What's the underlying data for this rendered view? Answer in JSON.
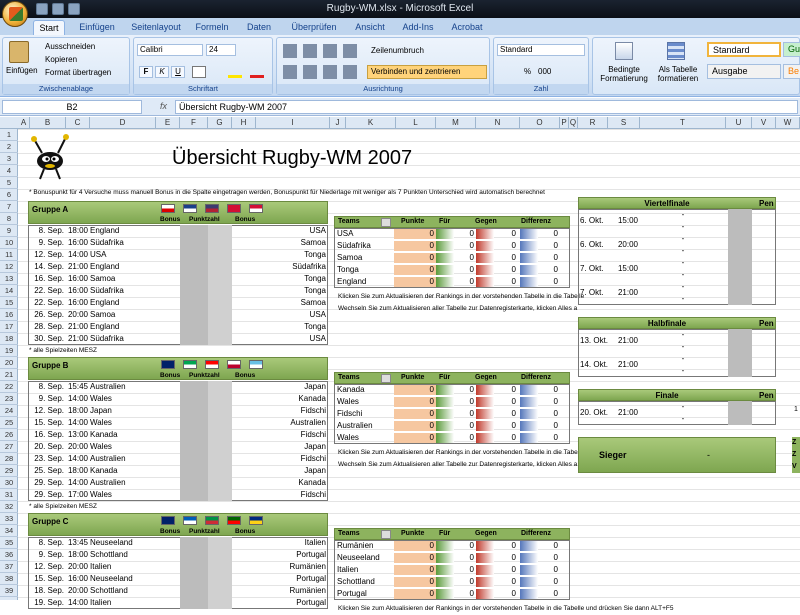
{
  "window": {
    "title": "Rugby-WM.xlsx - Microsoft Excel"
  },
  "tabs": [
    "Start",
    "Einfügen",
    "Seitenlayout",
    "Formeln",
    "Daten",
    "Überprüfen",
    "Ansicht",
    "Add-Ins",
    "Acrobat"
  ],
  "ribbon": {
    "clipboard": {
      "label": "Zwischenablage",
      "paste": "Einfügen",
      "cut": "Ausschneiden",
      "copy": "Kopieren",
      "format_painter": "Format übertragen"
    },
    "font": {
      "label": "Schriftart",
      "name": "Calibri",
      "size": "24",
      "bold": "F",
      "italic": "K",
      "underline": "U"
    },
    "alignment": {
      "label": "Ausrichtung",
      "wrap": "Zeilenumbruch",
      "merge": "Verbinden und zentrieren"
    },
    "number": {
      "label": "Zahl",
      "format": "Standard",
      "percent": "%",
      "thousands": "000"
    },
    "styles": {
      "cond_format": "Bedingte Formatierung",
      "table_format": "Als Tabelle formatieren",
      "style_standard": "Standard",
      "style_ausgabe": "Ausgabe",
      "style_gut": "Gu",
      "style_berechnung": "Be"
    }
  },
  "formula_bar": {
    "name_box": "B2",
    "fx": "fx",
    "value": "Übersicht Rugby-WM 2007"
  },
  "columns": [
    "A",
    "B",
    "C",
    "D",
    "E",
    "F",
    "G",
    "H",
    "I",
    "J",
    "K",
    "L",
    "M",
    "N",
    "O",
    "P",
    "Q",
    "R",
    "S",
    "T",
    "U",
    "V",
    "W"
  ],
  "rows": [
    "1",
    "2",
    "3",
    "4",
    "5",
    "6",
    "7",
    "8",
    "9",
    "10",
    "11",
    "12",
    "13",
    "14",
    "15",
    "16",
    "17",
    "18",
    "19",
    "20",
    "21",
    "22",
    "23",
    "24",
    "25",
    "26",
    "27",
    "28",
    "29",
    "30",
    "31",
    "32",
    "33",
    "34",
    "35",
    "36",
    "37",
    "38",
    "39"
  ],
  "sheet": {
    "title": "Übersicht Rugby-WM 2007",
    "note": "* Bonuspunkt für 4 Versuche muss manuell Bonus in die Spalte eingetragen werden, Bonuspunkt für Niederlage mit weniger als 7 Punkten Unterschied wird automatisch berechnet",
    "tz_note": "* alle Spielzeiten MESZ",
    "col_bonus": "Bonus",
    "col_punktzahl": "Punktzahl",
    "standing_cols": {
      "teams": "Teams",
      "punkte": "Punkte",
      "fuer": "Für",
      "gegen": "Gegen",
      "differenz": "Differenz"
    },
    "click_note": "Klicken Sie zum Aktualisieren der Rankings in der vorstehenden Tabelle in die Tabelle",
    "click_note_c": "Klicken Sie zum Aktualisieren der Rankings in der vorstehenden Tabelle in die Tabelle und drücken Sie dann ALT+F5",
    "refresh_note": "Wechseln Sie zum Aktualisieren aller Tabelle zur Datenregisterkarte, klicken Alles a",
    "zero": "0",
    "groups": [
      {
        "name": "Gruppe A",
        "matches": [
          [
            "8. Sep.",
            "18:00",
            "England",
            "USA"
          ],
          [
            "9. Sep.",
            "16:00",
            "Südafrika",
            "Samoa"
          ],
          [
            "12. Sep.",
            "14:00",
            "USA",
            "Tonga"
          ],
          [
            "14. Sep.",
            "21:00",
            "England",
            "Südafrika"
          ],
          [
            "16. Sep.",
            "16:00",
            "Samoa",
            "Tonga"
          ],
          [
            "22. Sep.",
            "16:00",
            "Südafrika",
            "Tonga"
          ],
          [
            "22. Sep.",
            "16:00",
            "England",
            "Samoa"
          ],
          [
            "26. Sep.",
            "20:00",
            "Samoa",
            "USA"
          ],
          [
            "28. Sep.",
            "21:00",
            "England",
            "Tonga"
          ],
          [
            "30. Sep.",
            "21:00",
            "Südafrika",
            "USA"
          ]
        ],
        "teams": [
          "USA",
          "Südafrika",
          "Samoa",
          "Tonga",
          "England"
        ]
      },
      {
        "name": "Gruppe B",
        "matches": [
          [
            "8. Sep.",
            "15:45",
            "Australien",
            "Japan"
          ],
          [
            "9. Sep.",
            "14:00",
            "Wales",
            "Kanada"
          ],
          [
            "12. Sep.",
            "18:00",
            "Japan",
            "Fidschi"
          ],
          [
            "15. Sep.",
            "14:00",
            "Wales",
            "Australien"
          ],
          [
            "16. Sep.",
            "13:00",
            "Kanada",
            "Fidschi"
          ],
          [
            "20. Sep.",
            "20:00",
            "Wales",
            "Japan"
          ],
          [
            "23. Sep.",
            "14:00",
            "Australien",
            "Fidschi"
          ],
          [
            "25. Sep.",
            "18:00",
            "Kanada",
            "Japan"
          ],
          [
            "29. Sep.",
            "14:00",
            "Australien",
            "Kanada"
          ],
          [
            "29. Sep.",
            "17:00",
            "Wales",
            "Fidschi"
          ]
        ],
        "teams": [
          "Kanada",
          "Wales",
          "Fidschi",
          "Australien",
          "Wales"
        ]
      },
      {
        "name": "Gruppe C",
        "matches": [
          [
            "8. Sep.",
            "13:45",
            "Neuseeland",
            "Italien"
          ],
          [
            "9. Sep.",
            "18:00",
            "Schottland",
            "Portugal"
          ],
          [
            "12. Sep.",
            "20:00",
            "Italien",
            "Rumänien"
          ],
          [
            "15. Sep.",
            "16:00",
            "Neuseeland",
            "Portugal"
          ],
          [
            "18. Sep.",
            "20:00",
            "Schottland",
            "Rumänien"
          ],
          [
            "19. Sep.",
            "14:00",
            "Italien",
            "Portugal"
          ]
        ],
        "teams": [
          "Rumänien",
          "Neuseeland",
          "Italien",
          "Schottland",
          "Portugal"
        ]
      }
    ],
    "knockout": {
      "viertelfinale": {
        "label": "Viertelfinale",
        "pen": "Pen",
        "games": [
          [
            "6. Okt.",
            "15:00"
          ],
          [
            "6. Okt.",
            "20:00"
          ],
          [
            "7. Okt.",
            "15:00"
          ],
          [
            "7. Okt.",
            "21:00"
          ]
        ]
      },
      "halbfinale": {
        "label": "Halbfinale",
        "pen": "Pen",
        "games": [
          [
            "13. Okt.",
            "21:00"
          ],
          [
            "14. Okt.",
            "21:00"
          ]
        ]
      },
      "finale": {
        "label": "Finale",
        "pen": "Pen",
        "games": [
          [
            "20. Okt.",
            "21:00"
          ]
        ]
      },
      "sieger": {
        "label": "Sieger",
        "value": "-"
      },
      "dash": "-",
      "edge_one": "1",
      "edge_z": [
        "Z",
        "Z",
        "V"
      ]
    }
  },
  "colors": {
    "header_green": "#8db35e",
    "punkte_orange": "#f6c7a0",
    "fuer_green": "#5a9a3a",
    "gegen_red": "#c0392b",
    "diff_blue": "#5577bb"
  }
}
